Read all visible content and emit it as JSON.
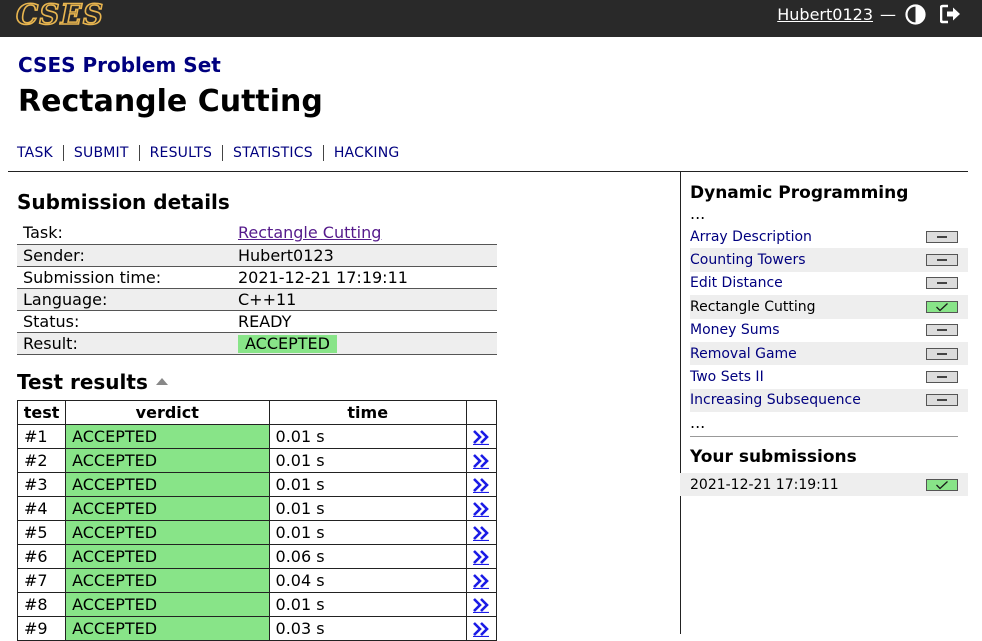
{
  "header": {
    "logo": "CSES",
    "username": "Hubert0123",
    "separator": "—",
    "theme_icon": "contrast-icon",
    "logout_icon": "logout-icon"
  },
  "set_title": "CSES Problem Set",
  "page_title": "Rectangle Cutting",
  "nav": [
    "TASK",
    "SUBMIT",
    "RESULTS",
    "STATISTICS",
    "HACKING"
  ],
  "submission": {
    "heading": "Submission details",
    "rows": [
      {
        "key": "Task:",
        "value": "Rectangle Cutting"
      },
      {
        "key": "Sender:",
        "value": "Hubert0123"
      },
      {
        "key": "Submission time:",
        "value": "2021-12-21 17:19:11"
      },
      {
        "key": "Language:",
        "value": "C++11"
      },
      {
        "key": "Status:",
        "value": "READY"
      },
      {
        "key": "Result:",
        "value": "ACCEPTED"
      }
    ]
  },
  "tests": {
    "heading": "Test results",
    "columns": [
      "test",
      "verdict",
      "time"
    ],
    "rows": [
      {
        "test": "#1",
        "verdict": "ACCEPTED",
        "time": "0.01 s"
      },
      {
        "test": "#2",
        "verdict": "ACCEPTED",
        "time": "0.01 s"
      },
      {
        "test": "#3",
        "verdict": "ACCEPTED",
        "time": "0.01 s"
      },
      {
        "test": "#4",
        "verdict": "ACCEPTED",
        "time": "0.01 s"
      },
      {
        "test": "#5",
        "verdict": "ACCEPTED",
        "time": "0.01 s"
      },
      {
        "test": "#6",
        "verdict": "ACCEPTED",
        "time": "0.06 s"
      },
      {
        "test": "#7",
        "verdict": "ACCEPTED",
        "time": "0.04 s"
      },
      {
        "test": "#8",
        "verdict": "ACCEPTED",
        "time": "0.01 s"
      },
      {
        "test": "#9",
        "verdict": "ACCEPTED",
        "time": "0.03 s"
      }
    ],
    "link_glyph": "»"
  },
  "sidebar": {
    "heading": "Dynamic Programming",
    "ellipsis": "...",
    "problems": [
      {
        "name": "Array Description",
        "status": "none"
      },
      {
        "name": "Counting Towers",
        "status": "none"
      },
      {
        "name": "Edit Distance",
        "status": "none"
      },
      {
        "name": "Rectangle Cutting",
        "status": "solved"
      },
      {
        "name": "Money Sums",
        "status": "none"
      },
      {
        "name": "Removal Game",
        "status": "none"
      },
      {
        "name": "Two Sets II",
        "status": "none"
      },
      {
        "name": "Increasing Subsequence",
        "status": "none"
      }
    ],
    "your_submissions_heading": "Your submissions",
    "submissions": [
      {
        "time": "2021-12-21 17:19:11",
        "status": "solved"
      }
    ]
  },
  "colors": {
    "accepted": "#88e488",
    "link": "#00007f",
    "topbar": "#292929"
  }
}
